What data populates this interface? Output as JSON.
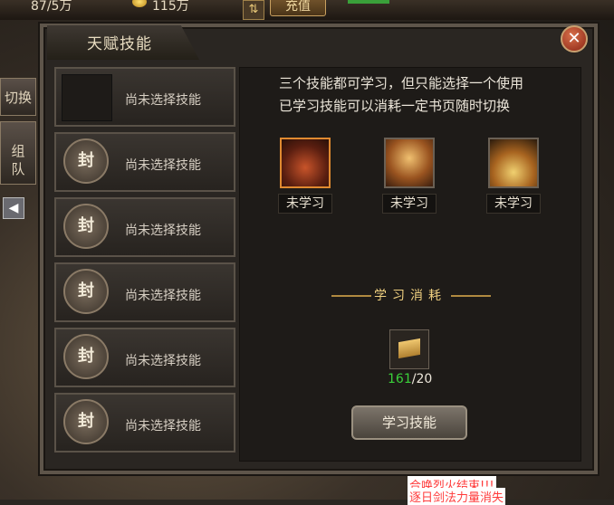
{
  "topbar": {
    "gold": "87/5万",
    "ingot": "115万",
    "arrow_icon": "⇅",
    "recharge": "充值"
  },
  "side": {
    "switch": "切换",
    "team": "组\n队",
    "back_icon": "◀"
  },
  "panel": {
    "title": "天赋技能",
    "close_icon": "✕"
  },
  "slots": [
    {
      "label": "尚未选择技能",
      "icon": "empty"
    },
    {
      "label": "尚未选择技能",
      "seal": "封"
    },
    {
      "label": "尚未选择技能",
      "seal": "封"
    },
    {
      "label": "尚未选择技能",
      "seal": "封"
    },
    {
      "label": "尚未选择技能",
      "seal": "封"
    },
    {
      "label": "尚未选择技能",
      "seal": "封"
    }
  ],
  "content": {
    "desc_line1": "三个技能都可学习，但只能选择一个使用",
    "desc_line2": "已学习技能可以消耗一定书页随时切换",
    "skills": [
      {
        "status": "未学习",
        "icon": "strength-skill-icon"
      },
      {
        "status": "未学习",
        "icon": "aura-skill-icon"
      },
      {
        "status": "未学习",
        "icon": "claw-skill-icon"
      }
    ],
    "cost_title": "学习消耗",
    "cost_have": "161",
    "cost_need": "/20",
    "learn_button": "学习技能"
  },
  "chat": {
    "line1": "合唤烈火结束!!!",
    "line2": "逐日剑法力量消失"
  }
}
